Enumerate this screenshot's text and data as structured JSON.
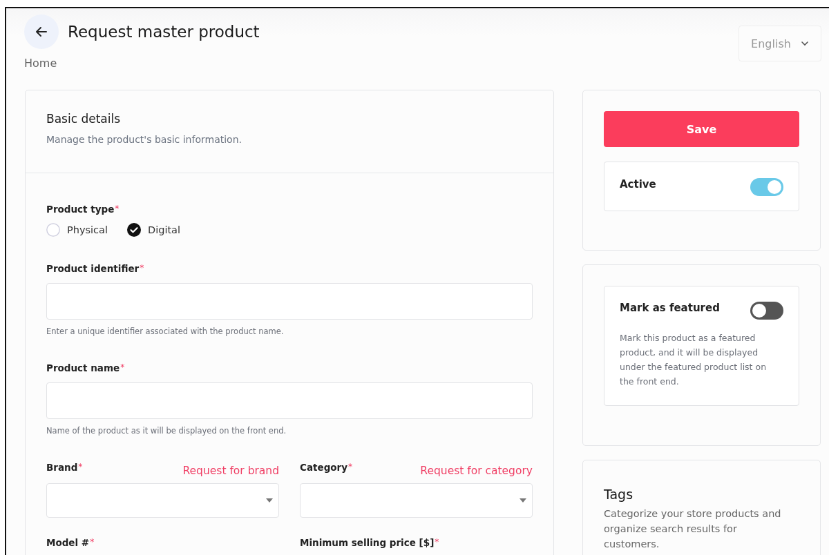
{
  "header": {
    "title": "Request master product",
    "breadcrumb": "Home",
    "language": "English"
  },
  "basic_details": {
    "title": "Basic details",
    "subtitle": "Manage the product's basic information.",
    "product_type": {
      "label": "Product type",
      "required_mark": "*",
      "options": [
        {
          "label": "Physical",
          "selected": false
        },
        {
          "label": "Digital",
          "selected": true
        }
      ]
    },
    "fields": [
      {
        "label": "Product identifier",
        "required_mark": "*",
        "hint": "Enter a unique identifier associated with the product name."
      },
      {
        "label": "Product name",
        "required_mark": "*",
        "hint": "Name of the product as it will be displayed on the front end."
      }
    ],
    "selects": [
      {
        "label": "Brand",
        "required_mark": "*",
        "link": "Request for brand"
      },
      {
        "label": "Category",
        "required_mark": "*",
        "link": "Request for category"
      }
    ],
    "bottom_labels": [
      {
        "label": "Model #",
        "required_mark": "*"
      },
      {
        "label": "Minimum selling price [$]",
        "required_mark": "*"
      }
    ]
  },
  "sidebar": {
    "save": "Save",
    "active": {
      "label": "Active",
      "on": true
    },
    "featured": {
      "label": "Mark as featured",
      "on": false,
      "description": "Mark this product as a featured product, and it will be displayed under the featured product list on the front end."
    },
    "tags": {
      "title": "Tags",
      "description": "Categorize your store products and organize search results for customers."
    }
  }
}
